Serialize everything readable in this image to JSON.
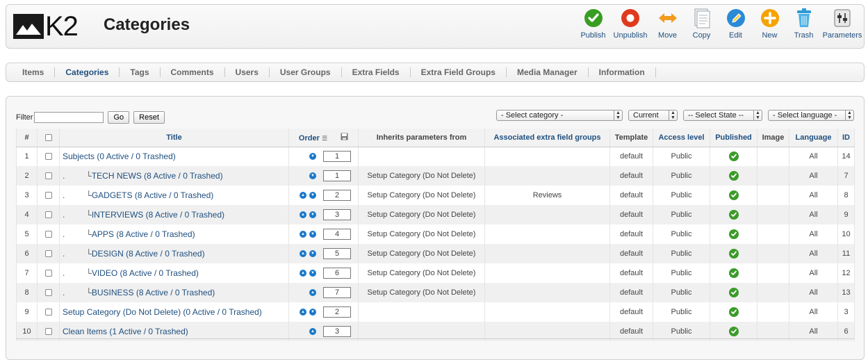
{
  "app": {
    "logo": "K2",
    "title": "Categories"
  },
  "toolbar": [
    {
      "label": "Publish",
      "icon": "publish-icon",
      "color": "#3a9d23"
    },
    {
      "label": "Unpublish",
      "icon": "unpublish-icon",
      "color": "#e03a1e"
    },
    {
      "label": "Move",
      "icon": "move-icon",
      "color": "#f29b1c"
    },
    {
      "label": "Copy",
      "icon": "copy-icon",
      "color": "#9aa3ab"
    },
    {
      "label": "Edit",
      "icon": "edit-icon",
      "color": "#2b8ad6"
    },
    {
      "label": "New",
      "icon": "new-icon",
      "color": "#f5a300"
    },
    {
      "label": "Trash",
      "icon": "trash-icon",
      "color": "#2e9bd6"
    },
    {
      "label": "Parameters",
      "icon": "parameters-icon",
      "color": "#777777"
    }
  ],
  "submenu": [
    "Items",
    "Categories",
    "Tags",
    "Comments",
    "Users",
    "User Groups",
    "Extra Fields",
    "Extra Field Groups",
    "Media Manager",
    "Information"
  ],
  "filter": {
    "label": "Filter",
    "value": "",
    "go": "Go",
    "reset": "Reset"
  },
  "selects": {
    "category": "- Select category -",
    "current": "Current",
    "state": "-- Select State --",
    "language": "- Select language -"
  },
  "columns": {
    "num": "#",
    "title": "Title",
    "order": "Order",
    "inherits": "Inherits parameters from",
    "extra": "Associated extra field groups",
    "template": "Template",
    "access": "Access level",
    "published": "Published",
    "image": "Image",
    "language": "Language",
    "id": "ID"
  },
  "rows": [
    {
      "num": "1",
      "indent": "",
      "title": "Subjects (0 Active / 0 Trashed)",
      "up": false,
      "down": true,
      "order": "1",
      "inherits": "",
      "extra": "",
      "template": "default",
      "access": "Public",
      "published": true,
      "image": "",
      "language": "All",
      "id": "14"
    },
    {
      "num": "2",
      "indent": ".         └",
      "title": "TECH NEWS (8 Active / 0 Trashed)",
      "up": false,
      "down": true,
      "order": "1",
      "inherits": "Setup Category (Do Not Delete)",
      "extra": "",
      "template": "default",
      "access": "Public",
      "published": true,
      "image": "",
      "language": "All",
      "id": "7"
    },
    {
      "num": "3",
      "indent": ".         └",
      "title": "GADGETS (8 Active / 0 Trashed)",
      "up": true,
      "down": true,
      "order": "2",
      "inherits": "Setup Category (Do Not Delete)",
      "extra": "Reviews",
      "template": "default",
      "access": "Public",
      "published": true,
      "image": "",
      "language": "All",
      "id": "8"
    },
    {
      "num": "4",
      "indent": ".         └",
      "title": "INTERVIEWS (8 Active / 0 Trashed)",
      "up": true,
      "down": true,
      "order": "3",
      "inherits": "Setup Category (Do Not Delete)",
      "extra": "",
      "template": "default",
      "access": "Public",
      "published": true,
      "image": "",
      "language": "All",
      "id": "9"
    },
    {
      "num": "5",
      "indent": ".         └",
      "title": "APPS (8 Active / 0 Trashed)",
      "up": true,
      "down": true,
      "order": "4",
      "inherits": "Setup Category (Do Not Delete)",
      "extra": "",
      "template": "default",
      "access": "Public",
      "published": true,
      "image": "",
      "language": "All",
      "id": "10"
    },
    {
      "num": "6",
      "indent": ".         └",
      "title": "DESIGN (8 Active / 0 Trashed)",
      "up": true,
      "down": true,
      "order": "5",
      "inherits": "Setup Category (Do Not Delete)",
      "extra": "",
      "template": "default",
      "access": "Public",
      "published": true,
      "image": "",
      "language": "All",
      "id": "11"
    },
    {
      "num": "7",
      "indent": ".         └",
      "title": "VIDEO (8 Active / 0 Trashed)",
      "up": true,
      "down": true,
      "order": "6",
      "inherits": "Setup Category (Do Not Delete)",
      "extra": "",
      "template": "default",
      "access": "Public",
      "published": true,
      "image": "",
      "language": "All",
      "id": "12"
    },
    {
      "num": "8",
      "indent": ".         └",
      "title": "BUSINESS (8 Active / 0 Trashed)",
      "up": true,
      "down": false,
      "order": "7",
      "inherits": "Setup Category (Do Not Delete)",
      "extra": "",
      "template": "default",
      "access": "Public",
      "published": true,
      "image": "",
      "language": "All",
      "id": "13"
    },
    {
      "num": "9",
      "indent": "",
      "title": "Setup Category (Do Not Delete) (0 Active / 0 Trashed)",
      "up": true,
      "down": true,
      "order": "2",
      "inherits": "",
      "extra": "",
      "template": "default",
      "access": "Public",
      "published": true,
      "image": "",
      "language": "All",
      "id": "3"
    },
    {
      "num": "10",
      "indent": "",
      "title": "Clean Items (1 Active / 0 Trashed)",
      "up": true,
      "down": false,
      "order": "3",
      "inherits": "",
      "extra": "",
      "template": "default",
      "access": "Public",
      "published": true,
      "image": "",
      "language": "All",
      "id": "6"
    }
  ]
}
